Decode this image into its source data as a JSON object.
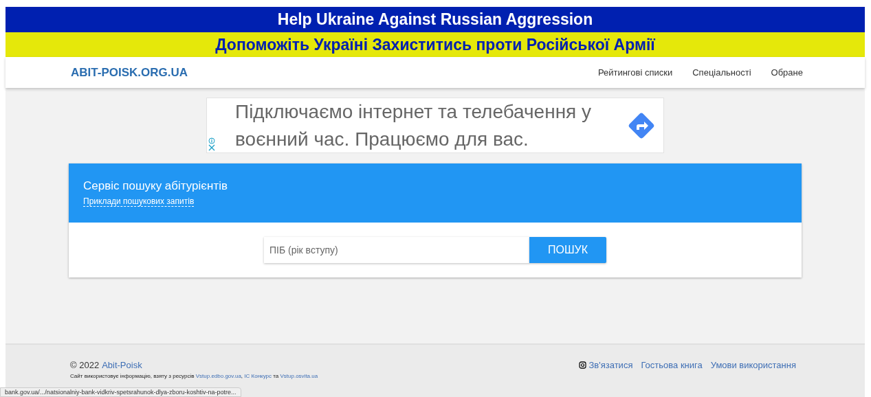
{
  "banner": {
    "english": "Help Ukraine Against Russian Aggression",
    "ukrainian": "Допоможіть Україні Захиститись проти Російської Армії"
  },
  "navbar": {
    "logo": "ABIT-POISK.ORG.UA",
    "links": [
      "Рейтингові списки",
      "Спеціальності",
      "Обране"
    ]
  },
  "ad": {
    "text": "Підключаємо інтернет та телебачення у воєнний час. Працюємо для вас."
  },
  "search_card": {
    "title": "Сервіс пошуку абітурієнтів",
    "examples_link": "Приклади пошукових запитів",
    "placeholder": "ПІБ (рік вступу)",
    "button": "ПОШУК"
  },
  "footer": {
    "copyright": "© 2022",
    "brand": "Abit-Poisk",
    "note": [
      {
        "kind": "text",
        "text": "Сайт використовує інформацію, взяту з ресурсів "
      },
      {
        "kind": "link",
        "text": "Vstup.edbo.gov.ua"
      },
      {
        "kind": "text",
        "text": ", "
      },
      {
        "kind": "link",
        "text": "ІС Конкурс"
      },
      {
        "kind": "text",
        "text": " та "
      },
      {
        "kind": "link",
        "text": "Vstup.osvita.ua"
      }
    ],
    "links": [
      "Зв'язатися",
      "Гостьова книга",
      "Умови використання"
    ]
  },
  "status_bar": {
    "url": "bank.gov.ua/.../natsionalniy-bank-vidkriv-spetsrahunok-dlya-zboru-koshtiv-na-potre..."
  }
}
